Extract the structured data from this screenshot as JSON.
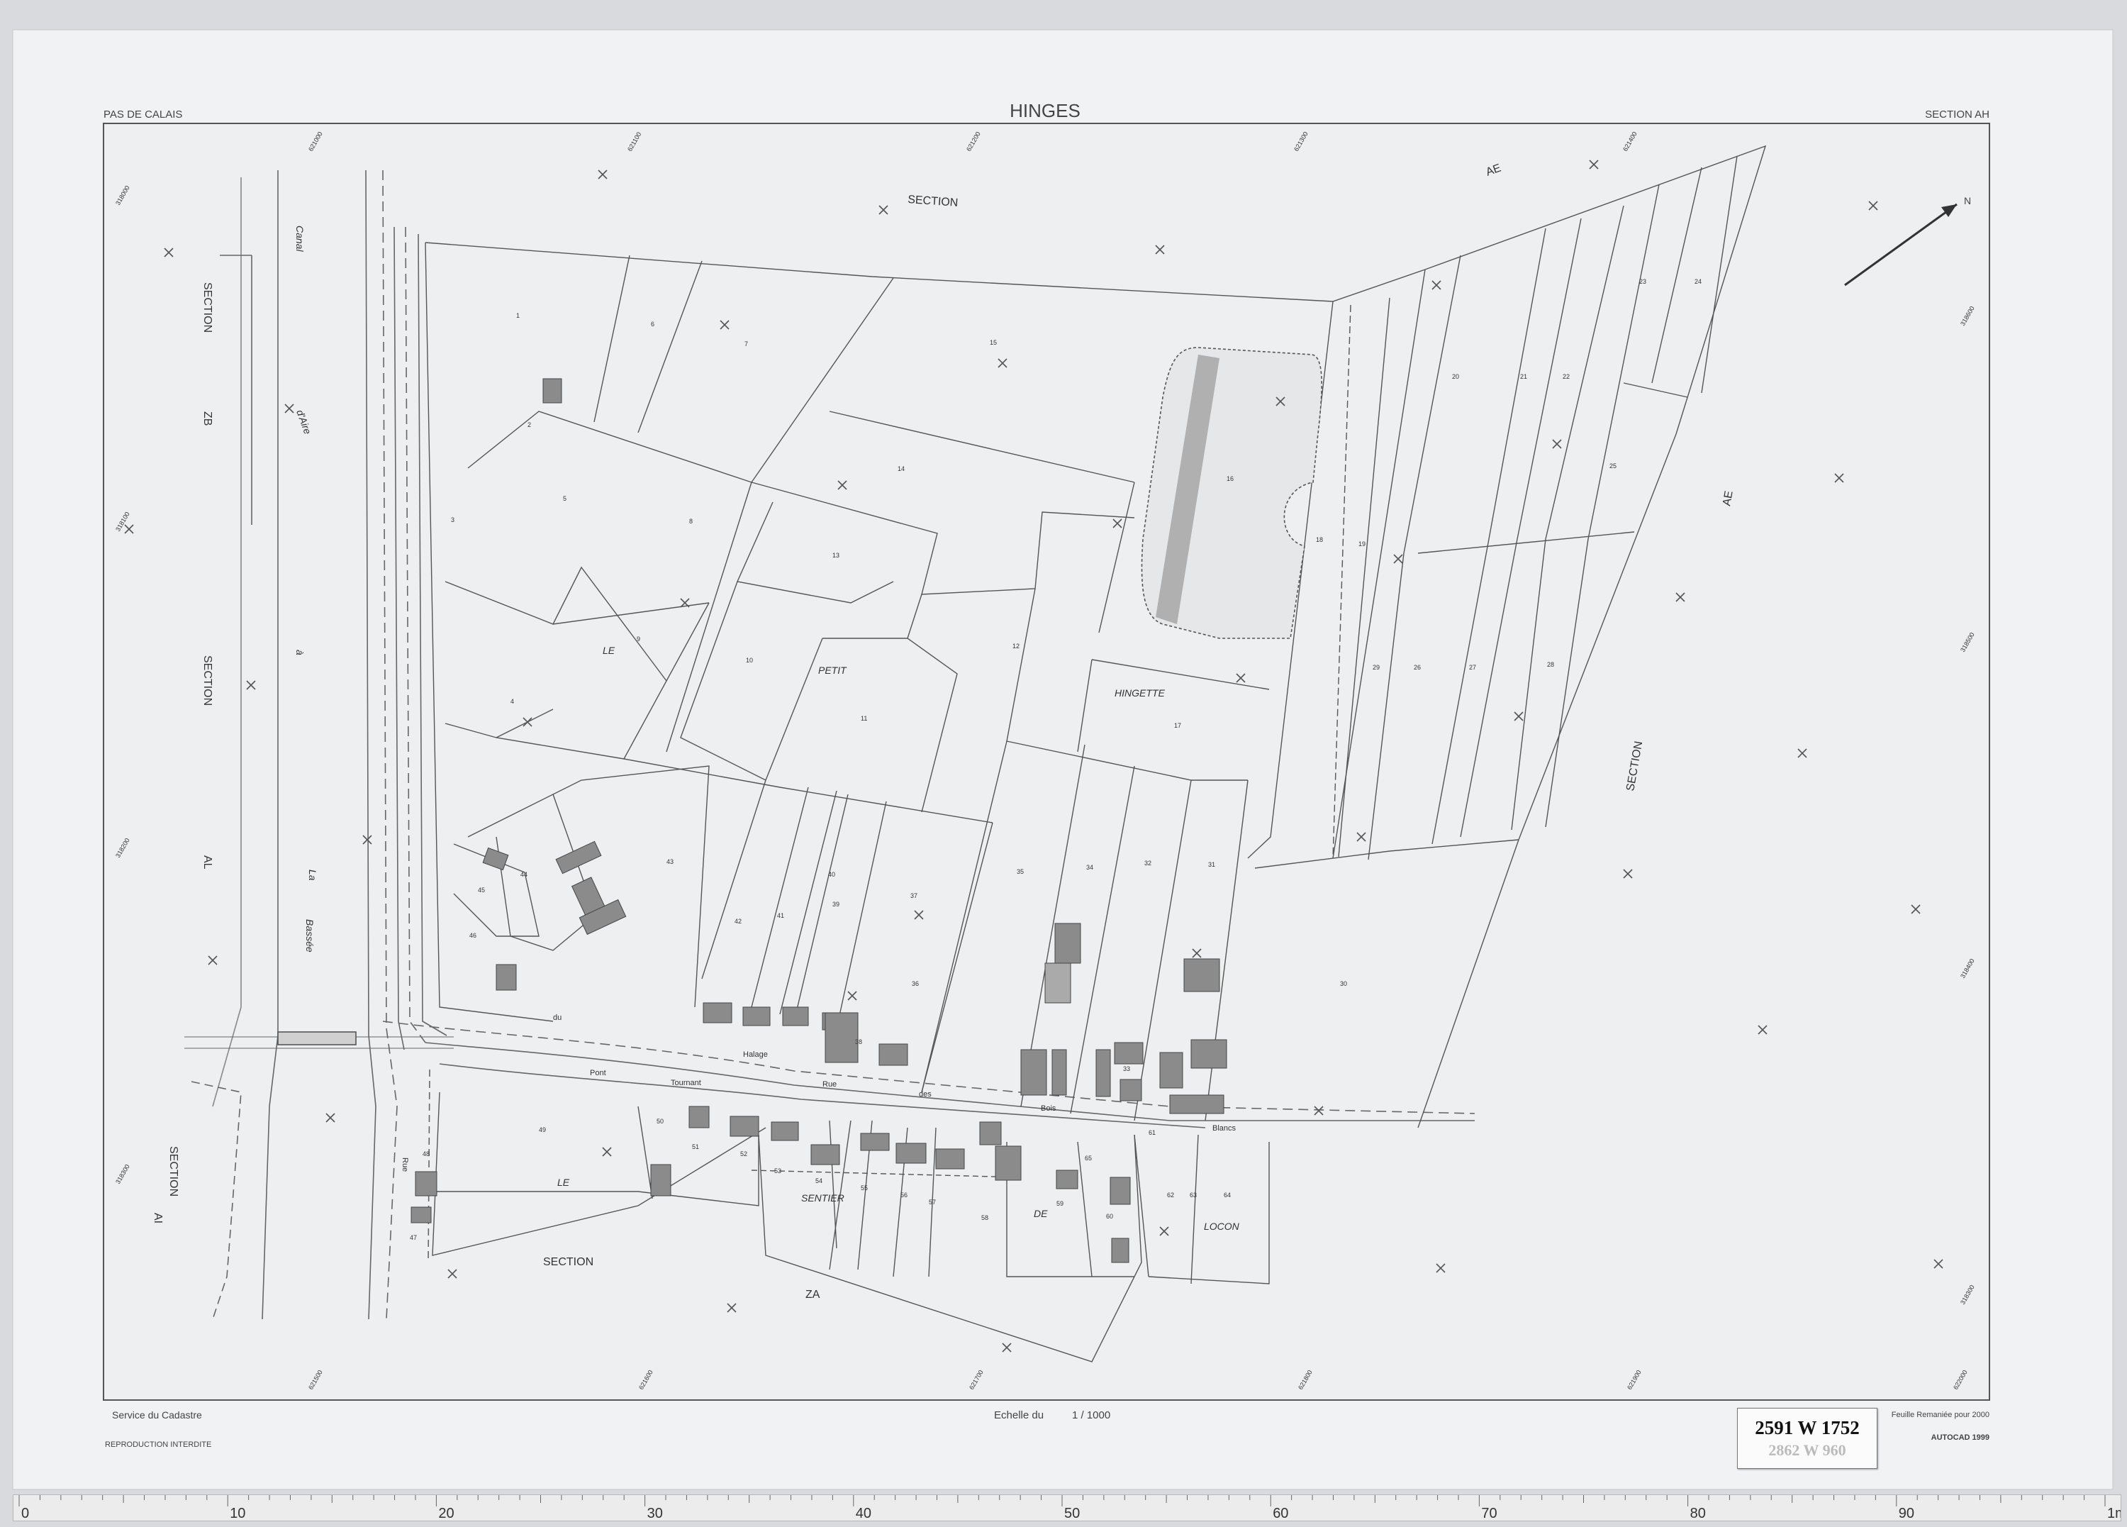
{
  "header": {
    "department": "PAS DE CALAIS",
    "commune": "HINGES",
    "section": "SECTION AH"
  },
  "footer": {
    "service": "Service du Cadastre",
    "reproduction": "REPRODUCTION  INTERDITE",
    "scale_prefix": "Echelle du",
    "scale_value": "1 / 1000",
    "remaniement": "Feuille Remaniée pour 2000",
    "software": "AUTOCAD 1999"
  },
  "stamp": {
    "reference": "2591 W 1752",
    "ghost_reference": "2862 W 960"
  },
  "compass": {
    "north_label": "N"
  },
  "coord_labels": {
    "top": [
      "621000",
      "621100",
      "621200",
      "621300",
      "621400"
    ],
    "bottom": [
      "621500",
      "621600",
      "621700",
      "621800",
      "621900",
      "622000"
    ],
    "left": [
      "318000",
      "318100",
      "318200",
      "318300"
    ],
    "right": [
      "318600",
      "318500",
      "318400",
      "318300",
      "318200"
    ]
  },
  "map_labels": {
    "section_ae_top": "SECTION",
    "section_ae_top_letters": "AE",
    "section_zb": "SECTION",
    "section_zb_letters": "ZB",
    "section_al": "SECTION",
    "section_al_letters": "AL",
    "section_ai": "SECTION",
    "section_ai_letters": "AI",
    "section_ae_right": "SECTION",
    "section_ae_right_letters": "AE",
    "section_za": "SECTION",
    "section_za_letters": "ZA",
    "canal_1": "Canal",
    "canal_2": "d'Aire",
    "canal_3": "à",
    "canal_4": "La",
    "canal_5": "Bassée",
    "lieu_le_petit_1": "LE",
    "lieu_le_petit_2": "PETIT",
    "lieu_hingette": "HINGETTE",
    "lieu_le_sentier_1": "LE",
    "lieu_le_sentier_2": "SENTIER",
    "lieu_de_locon_1": "DE",
    "lieu_de_locon_2": "LOCON",
    "road_du": "du",
    "road_halage": "Halage",
    "road_pont": "Pont",
    "road_tournant": "Tournant",
    "road_rue": "Rue",
    "road_des": "des",
    "road_bois": "Bois",
    "road_blancs": "Blancs",
    "road_rue2": "Rue"
  },
  "parcels": [
    "1",
    "2",
    "3",
    "4",
    "5",
    "6",
    "7",
    "8",
    "9",
    "10",
    "11",
    "12",
    "13",
    "14",
    "15",
    "16",
    "17",
    "18",
    "19",
    "20",
    "21",
    "22",
    "23",
    "24",
    "25",
    "26",
    "27",
    "28",
    "29",
    "30",
    "31",
    "32",
    "33",
    "34",
    "35",
    "36",
    "37",
    "38",
    "39",
    "40",
    "41",
    "42",
    "43",
    "44",
    "45",
    "46",
    "47",
    "48",
    "49",
    "50",
    "51",
    "52",
    "53",
    "54",
    "55",
    "56",
    "57",
    "58",
    "59",
    "60",
    "61",
    "62",
    "63",
    "64",
    "65"
  ],
  "ruler": {
    "labels": [
      "0",
      "10",
      "20",
      "30",
      "40",
      "50",
      "60",
      "70",
      "80",
      "90",
      "1m"
    ]
  }
}
